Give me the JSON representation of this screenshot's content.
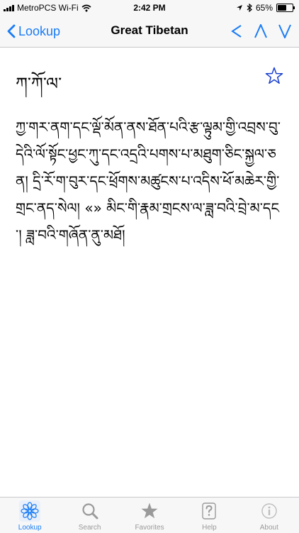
{
  "status_bar": {
    "carrier": "MetroPCS Wi-Fi",
    "time": "2:42 PM",
    "battery": "65%",
    "battery_level": 0.65
  },
  "nav": {
    "back_label": "Lookup",
    "title": "Great Tibetan",
    "prev_label": "<",
    "up_label": "Λ",
    "down_label": "V"
  },
  "entry": {
    "headword": "ཀ་ཀོ་ལ་",
    "definition": "ཀྱ་གར་ནག་དང་ལྡོ་མོན་ནས་ཐོན་པའི་རྩ་ལྟུམ་གྱི་འབྲས་བུ་དེའི་ལོ་སྟོང་ཕྱང་ཀུ་དང་འདྲའི་པགས་པ་མཐུག་ཅིང་སྐྱལ་ཅན། དྲི་རོ་ག་བུར་དང་ཕྲོགས་མཚུངས་པ་འདིས་ཕོ་མཆེར་གྱི་གྲང་ནད་སེལ། «» མིང་གི་རྣམ་གྲངས་ལ་ཟླ་བའི་བྲེ་མ་དང་། ཟླ་བའི་གཞོན་ནུ་མཐོ།"
  },
  "tabs": [
    {
      "label": "Lookup",
      "icon": "lotus-icon",
      "active": true
    },
    {
      "label": "Search",
      "icon": "search-icon",
      "active": false
    },
    {
      "label": "Favorites",
      "icon": "star-icon",
      "active": false
    },
    {
      "label": "Help",
      "icon": "help-icon",
      "active": false
    },
    {
      "label": "About",
      "icon": "info-icon",
      "active": false
    }
  ],
  "colors": {
    "accent": "#1a7cf5",
    "star": "#1a3fcf",
    "inactive_tab": "#9a9a9a",
    "bar_background": "#f7f7f7"
  }
}
